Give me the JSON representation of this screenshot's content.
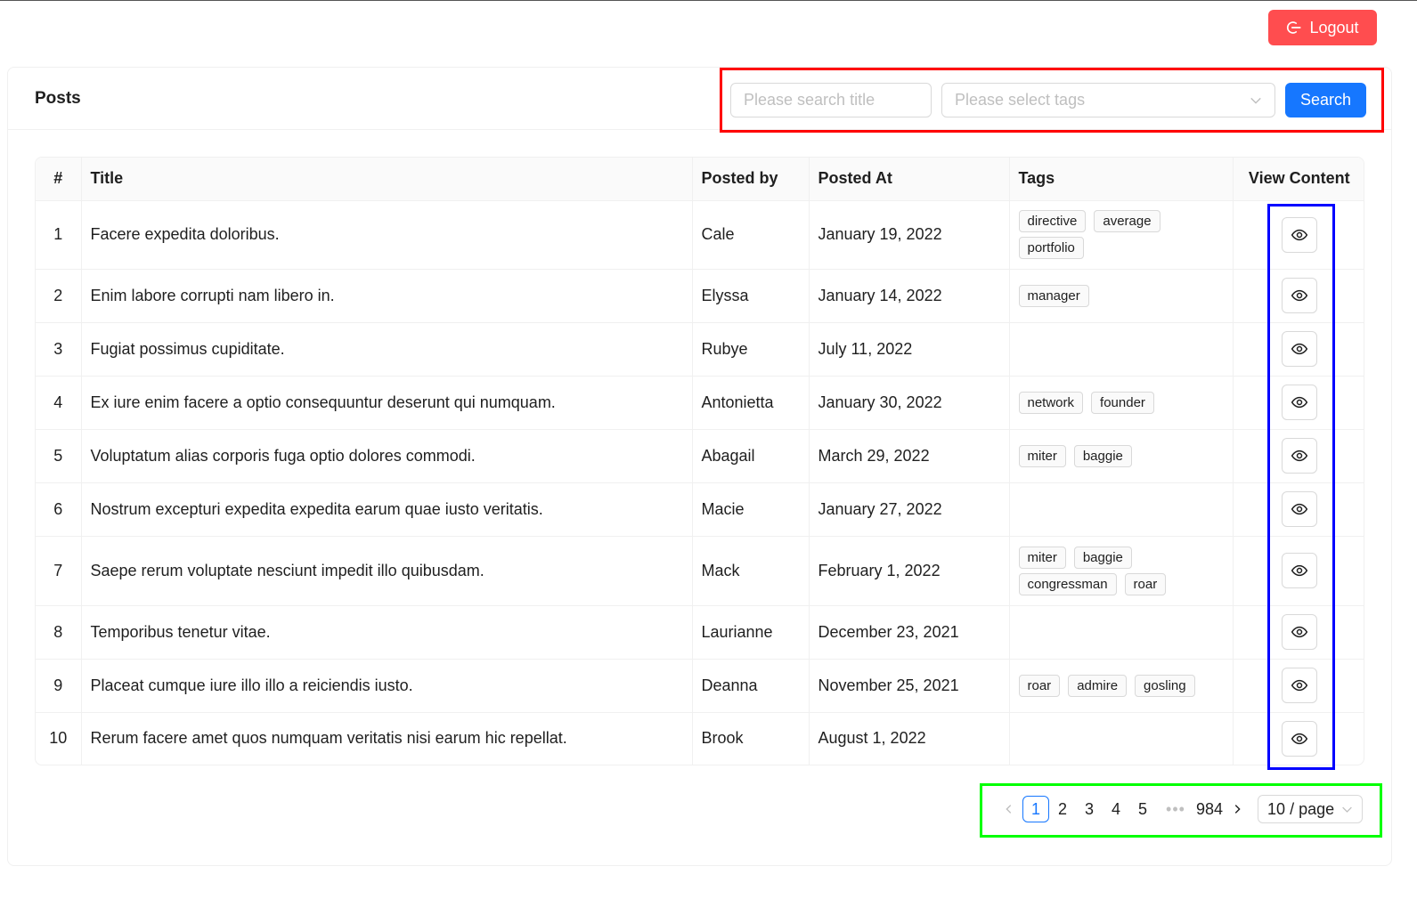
{
  "header": {
    "logout_label": "Logout"
  },
  "card": {
    "title": "Posts"
  },
  "search": {
    "title_placeholder": "Please search title",
    "tags_placeholder": "Please select tags",
    "button_label": "Search"
  },
  "table": {
    "columns": [
      "#",
      "Title",
      "Posted by",
      "Posted At",
      "Tags",
      "View Content"
    ],
    "rows": [
      {
        "num": "1",
        "title": "Facere expedita doloribus.",
        "posted_by": "Cale",
        "posted_at": "January 19, 2022",
        "tags": [
          "directive",
          "average",
          "portfolio"
        ]
      },
      {
        "num": "2",
        "title": "Enim labore corrupti nam libero in.",
        "posted_by": "Elyssa",
        "posted_at": "January 14, 2022",
        "tags": [
          "manager"
        ]
      },
      {
        "num": "3",
        "title": "Fugiat possimus cupiditate.",
        "posted_by": "Rubye",
        "posted_at": "July 11, 2022",
        "tags": []
      },
      {
        "num": "4",
        "title": "Ex iure enim facere a optio consequuntur deserunt qui numquam.",
        "posted_by": "Antonietta",
        "posted_at": "January 30, 2022",
        "tags": [
          "network",
          "founder"
        ]
      },
      {
        "num": "5",
        "title": "Voluptatum alias corporis fuga optio dolores commodi.",
        "posted_by": "Abagail",
        "posted_at": "March 29, 2022",
        "tags": [
          "miter",
          "baggie"
        ]
      },
      {
        "num": "6",
        "title": "Nostrum excepturi expedita expedita earum quae iusto veritatis.",
        "posted_by": "Macie",
        "posted_at": "January 27, 2022",
        "tags": []
      },
      {
        "num": "7",
        "title": "Saepe rerum voluptate nesciunt impedit illo quibusdam.",
        "posted_by": "Mack",
        "posted_at": "February 1, 2022",
        "tags": [
          "miter",
          "baggie",
          "congressman",
          "roar"
        ]
      },
      {
        "num": "8",
        "title": "Temporibus tenetur vitae.",
        "posted_by": "Laurianne",
        "posted_at": "December 23, 2021",
        "tags": []
      },
      {
        "num": "9",
        "title": "Placeat cumque iure illo illo a reiciendis iusto.",
        "posted_by": "Deanna",
        "posted_at": "November 25, 2021",
        "tags": [
          "roar",
          "admire",
          "gosling"
        ]
      },
      {
        "num": "10",
        "title": "Rerum facere amet quos numquam veritatis nisi earum hic repellat.",
        "posted_by": "Brook",
        "posted_at": "August 1, 2022",
        "tags": []
      }
    ],
    "view_icon": "eye-icon"
  },
  "pagination": {
    "pages": [
      "1",
      "2",
      "3",
      "4",
      "5"
    ],
    "current_page": "1",
    "ellipsis": "•••",
    "last_page": "984",
    "page_size": "10 / page"
  },
  "colors": {
    "logout_bg": "#ff4d4f",
    "primary": "#1677ff",
    "highlight_search": "#ff0000",
    "highlight_view": "#0000ff",
    "highlight_pagination": "#00ff00"
  }
}
